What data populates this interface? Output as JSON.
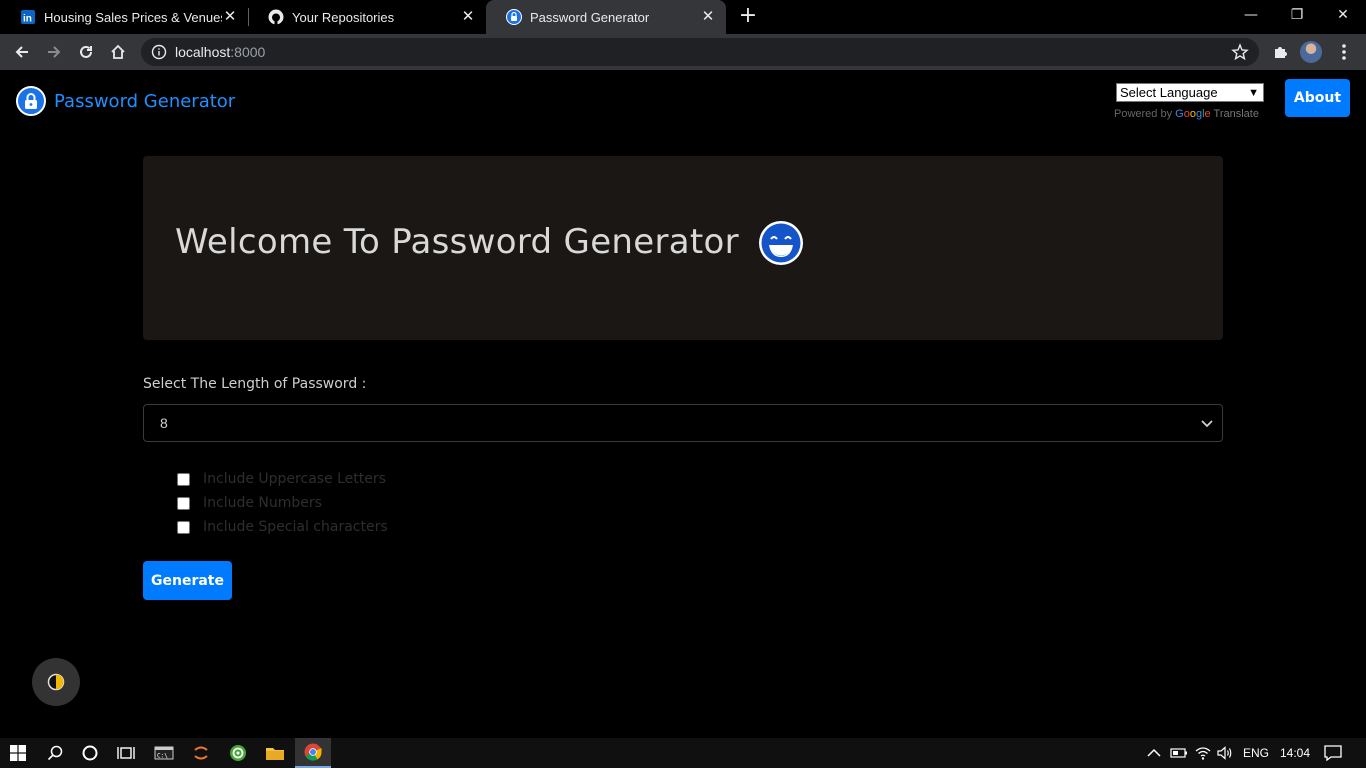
{
  "browser": {
    "tabs": [
      {
        "title": "Housing Sales Prices & Venues D",
        "icon": "linkedin-icon"
      },
      {
        "title": "Your Repositories",
        "icon": "github-icon"
      },
      {
        "title": "Password Generator",
        "icon": "lock-icon",
        "active": true
      }
    ],
    "url_host": "localhost",
    "url_port": ":8000"
  },
  "navbar": {
    "brand": "Password Generator",
    "language_select": "Select Language",
    "powered_by": "Powered by",
    "google_letters": [
      "G",
      "o",
      "o",
      "g",
      "l",
      "e"
    ],
    "translate": "Translate",
    "about": "About"
  },
  "hero": {
    "title": "Welcome To Password Generator",
    "emoji": "grinning-face-icon"
  },
  "form": {
    "length_label": "Select The Length of Password :",
    "length_value": "8",
    "options": [
      {
        "label": "Include Uppercase Letters",
        "checked": false
      },
      {
        "label": "Include Numbers",
        "checked": false
      },
      {
        "label": "Include Special characters",
        "checked": false
      }
    ],
    "generate": "Generate"
  },
  "taskbar": {
    "language": "ENG",
    "time": "14:04"
  },
  "colors": {
    "accent": "#007bff",
    "brand_text": "#1e90ff",
    "hero_bg": "#1a1715",
    "page_bg": "#000000"
  }
}
